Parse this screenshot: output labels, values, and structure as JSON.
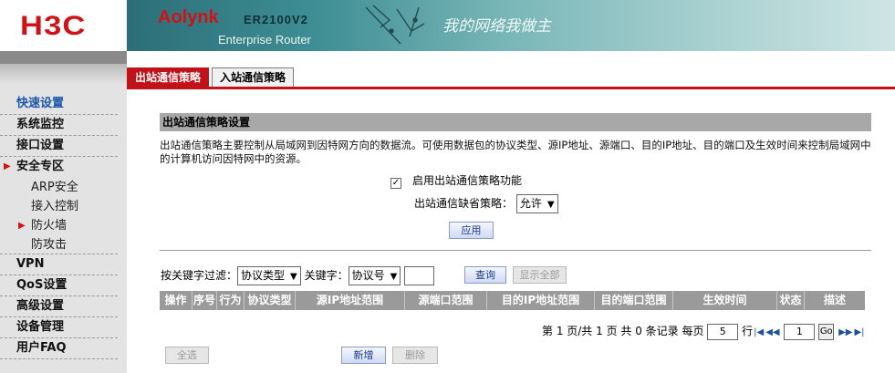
{
  "logo": {
    "text": "H3C"
  },
  "banner": {
    "brand": "Aolynk",
    "model": "ER2100V2",
    "subtitle": "Enterprise Router",
    "slogan": "我的网络我做主"
  },
  "sidebar": {
    "items": [
      {
        "label": "快速设置",
        "active": true
      },
      {
        "label": "系统监控"
      },
      {
        "label": "接口设置"
      },
      {
        "label": "安全专区",
        "expanded": true
      },
      {
        "label": "VPN"
      },
      {
        "label": "QoS设置"
      },
      {
        "label": "高级设置"
      },
      {
        "label": "设备管理"
      },
      {
        "label": "用户FAQ"
      }
    ],
    "sub_items": [
      {
        "label": "ARP安全"
      },
      {
        "label": "接入控制"
      },
      {
        "label": "防火墙",
        "current": true
      },
      {
        "label": "防攻击"
      }
    ]
  },
  "tabs": [
    {
      "label": "出站通信策略",
      "active": true
    },
    {
      "label": "入站通信策略",
      "active": false
    }
  ],
  "section": {
    "title": "出站通信策略设置",
    "description": "出站通信策略主要控制从局域网到因特网方向的数据流。可使用数据包的协议类型、源IP地址、源端口、目的IP地址、目的端口及生效时间来控制局域网中的计算机访问因特网中的资源。",
    "enable_label": "启用出站通信策略功能",
    "enable_checked": "✓",
    "default_policy_label": "出站通信缺省策略：",
    "default_policy_value": "允许",
    "apply_label": "应用"
  },
  "filter": {
    "label": "按关键字过滤：",
    "type_value": "协议类型",
    "keyword_label": "关键字：",
    "keyword_value": "协议号",
    "query_label": "查询",
    "show_all_label": "显示全部"
  },
  "table": {
    "columns": [
      "操作",
      "序号",
      "行为",
      "协议类型",
      "源IP地址范围",
      "源端口范围",
      "目的IP地址范围",
      "目的端口范围",
      "生效时间",
      "状态",
      "描述"
    ]
  },
  "pager": {
    "summary": "第 1 页/共 1 页 共 0 条记录 每页",
    "per_page": "5",
    "row_label": "行",
    "page_value": "1",
    "go_label": "Go"
  },
  "actions": {
    "select_all_label": "全选",
    "add_label": "新增",
    "delete_label": "删除"
  },
  "colors": {
    "brand_red": "#c1121a",
    "menu_active": "#1b56a8",
    "table_header": "#9a9a9a"
  }
}
